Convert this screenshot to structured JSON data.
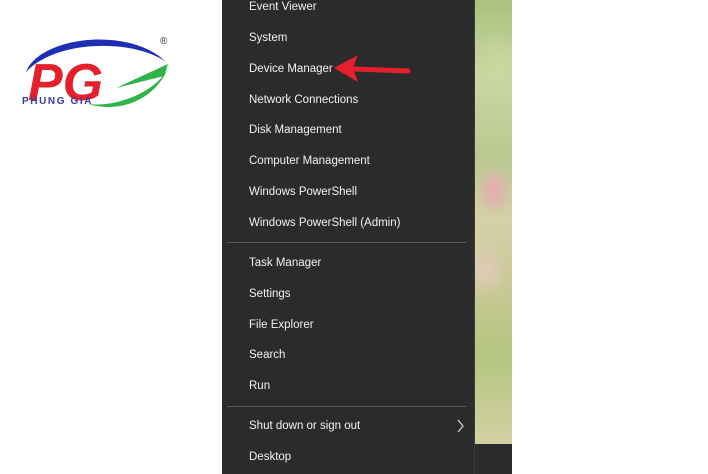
{
  "logo": {
    "letters": "PG",
    "caption": "PHUNG GIA",
    "registered_mark": "®",
    "colors": {
      "arc_blue": "#1f2fb4",
      "arc_green": "#2fb34a",
      "letters_red": "#e3202b"
    }
  },
  "menu": {
    "items_top": [
      {
        "label": "Event Viewer"
      },
      {
        "label": "System"
      },
      {
        "label": "Device Manager"
      },
      {
        "label": "Network Connections"
      },
      {
        "label": "Disk Management"
      },
      {
        "label": "Computer Management"
      },
      {
        "label": "Windows PowerShell"
      },
      {
        "label": "Windows PowerShell (Admin)"
      }
    ],
    "items_bottom": [
      {
        "label": "Task Manager"
      },
      {
        "label": "Settings"
      },
      {
        "label": "File Explorer"
      },
      {
        "label": "Search"
      },
      {
        "label": "Run"
      }
    ],
    "shutdown": {
      "label": "Shut down or sign out",
      "icon": "chevron-right-icon"
    },
    "desktop": {
      "label": "Desktop"
    }
  },
  "annotation": {
    "icon": "red-arrow-icon",
    "target": "Device Manager",
    "color": "#e3202b"
  }
}
